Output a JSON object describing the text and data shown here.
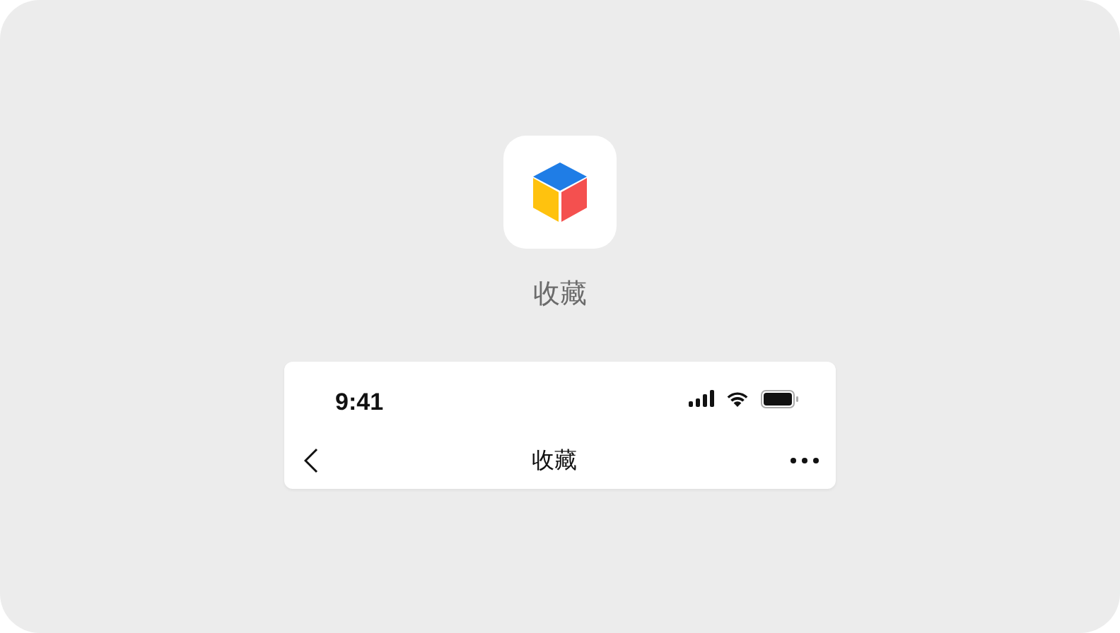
{
  "app": {
    "label": "收藏"
  },
  "status_bar": {
    "time": "9:41"
  },
  "nav_bar": {
    "title": "收藏"
  }
}
